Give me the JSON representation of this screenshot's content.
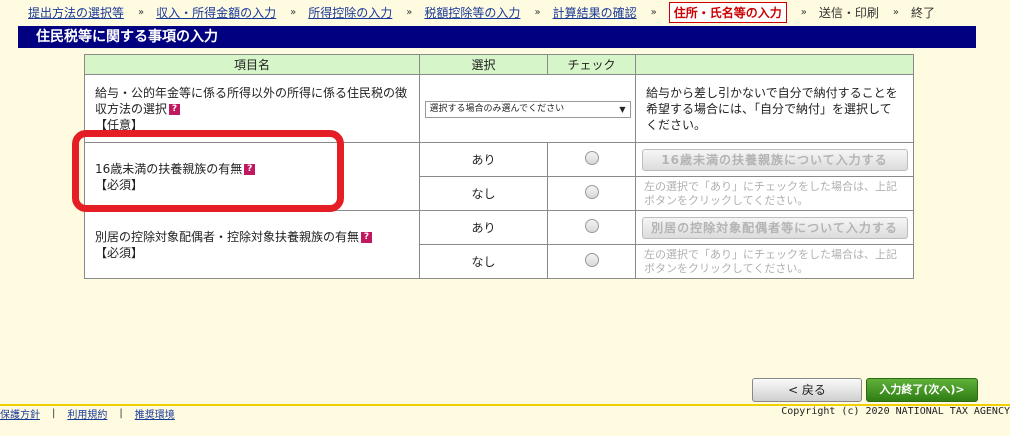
{
  "breadcrumb": {
    "steps": [
      "提出方法の選択等",
      "収入・所得金額の入力",
      "所得控除の入力",
      "税額控除等の入力",
      "計算結果の確認"
    ],
    "current": "住所・氏名等の入力",
    "after": [
      "送信・印刷",
      "終了"
    ],
    "separator": "»"
  },
  "page_title": "住民税等に関する事項の入力",
  "table": {
    "headers": {
      "item": "項目名",
      "select": "選択",
      "check": "チェック",
      "desc": ""
    },
    "row1": {
      "label_line1": "給与・公的年金等に係る所得以外の所得に係る住民税の徴",
      "label_line2": "収方法の選択",
      "tag": "【任意】",
      "select_value": "選択する場合のみ選んでください",
      "desc": "給与から差し引かないで自分で納付することを希望する場合には、「自分で納付」を選択してください。"
    },
    "row2": {
      "label": "16歳未満の扶養親族の有無",
      "tag": "【必須】",
      "opt_yes": "あり",
      "opt_no": "なし",
      "button": "16歳未満の扶養親族について入力する",
      "note": "左の選択で「あり」にチェックをした場合は、上記ボタンをクリックしてください。"
    },
    "row3": {
      "label": "別居の控除対象配偶者・控除対象扶養親族の有無",
      "tag": "【必須】",
      "opt_yes": "あり",
      "opt_no": "なし",
      "button": "別居の控除対象配偶者等について入力する",
      "note": "左の選択で「あり」にチェックをした場合は、上記ボタンをクリックしてください。"
    }
  },
  "icons": {
    "help": "?",
    "select_arrow": "▼"
  },
  "buttons": {
    "back": "< 戻る",
    "next": "入力終了(次へ)>"
  },
  "footer": {
    "links": [
      "保護方針",
      "利用規約",
      "推奨環境"
    ],
    "copyright": "Copyright (c) 2020 NATIONAL TAX AGENCY"
  },
  "colors": {
    "title_bg": "#000080",
    "highlight": "#e51e26",
    "next_btn": "#2f7d14"
  }
}
